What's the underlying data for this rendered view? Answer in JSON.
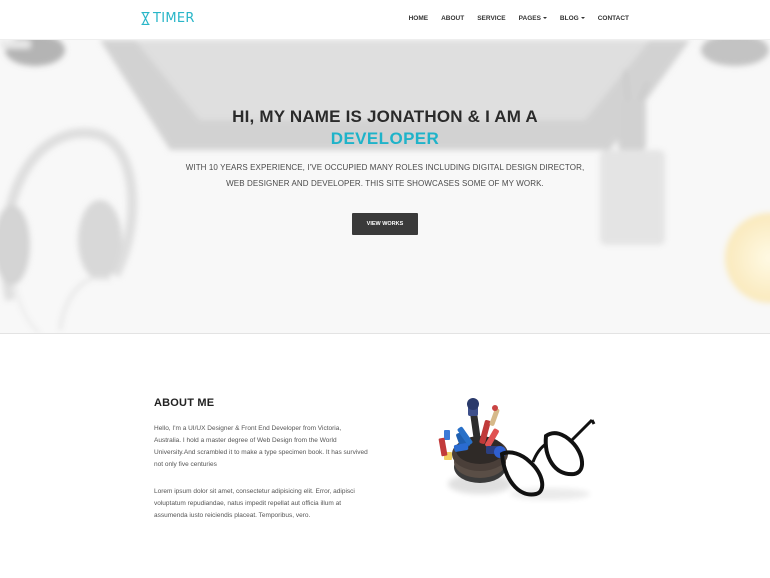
{
  "brand": {
    "name": "TIMER",
    "icon": "hourglass-icon",
    "color": "#29b6c8"
  },
  "nav": {
    "items": [
      {
        "label": "HOME",
        "dropdown": false
      },
      {
        "label": "ABOUT",
        "dropdown": false
      },
      {
        "label": "SERVICE",
        "dropdown": false
      },
      {
        "label": "PAGES",
        "dropdown": true
      },
      {
        "label": "BLOG",
        "dropdown": true
      },
      {
        "label": "CONTACT",
        "dropdown": false
      }
    ]
  },
  "hero": {
    "title": "HI, MY NAME IS JONATHON & I AM A",
    "highlight": "DEVELOPER",
    "subtitle_line1": "WITH 10 YEARS EXPERIENCE, I'VE OCCUPIED MANY ROLES INCLUDING DIGITAL DESIGN DIRECTOR,",
    "subtitle_line2": "WEB DESIGNER AND DEVELOPER. THIS SITE SHOWCASES SOME OF MY WORK.",
    "button_label": "VIEW WORKS",
    "accent_color": "#1fb3c9"
  },
  "about": {
    "title": "ABOUT ME",
    "paragraph1": "Hello, I'm a UI/UX Designer & Front End Developer from Victoria, Australia. I hold a master degree of Web Design from the World University.And scrambled it to make a type specimen book. It has survived not only five centuries",
    "paragraph2": "Lorem ipsum dolor sit amet, consectetur adipisicing elit. Error, adipisci voluptatum repudiandae, natus impedit repellat aut officia illum at assumenda iusto reiciendis placeat. Temporibus, vero."
  }
}
